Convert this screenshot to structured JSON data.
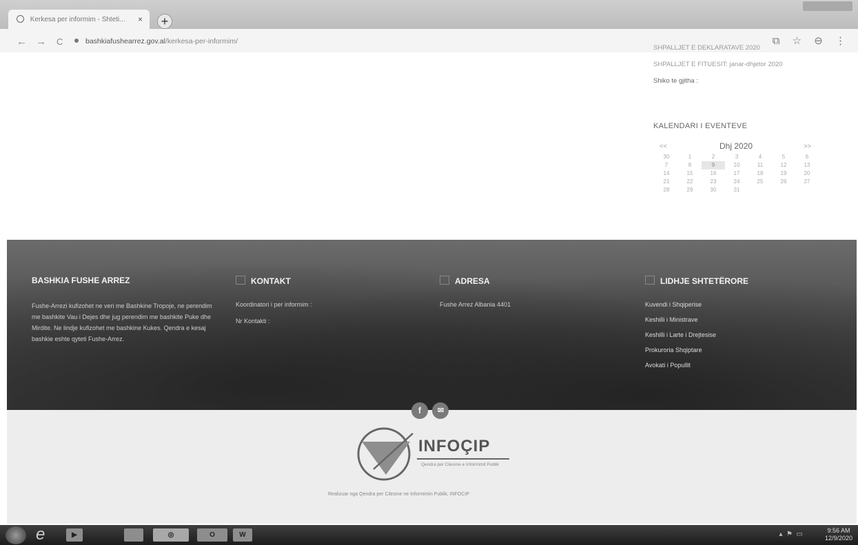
{
  "browser": {
    "tab_title": "Kerkesa per informim - Shteti...",
    "tab_close": "×",
    "new_tab": "+",
    "back": "←",
    "forward": "→",
    "reload": "C",
    "url_host": "bashkiafushearrez.gov.al",
    "url_path": "/kerkesa-per-informim/"
  },
  "sidebar": {
    "line1": "SHPALLJET E DEKLARATAVE 2020",
    "line2": "SHPALLJET E FITUESIT: janar-dhjetor 2020",
    "see_all": "Shiko te gjitha :",
    "calendar_title": "KALENDARI I EVENTEVE",
    "calendar": {
      "prev": "<<",
      "month": "Dhj 2020",
      "next": ">>",
      "rows": [
        [
          "30",
          "1",
          "2",
          "3",
          "4",
          "5",
          "6"
        ],
        [
          "7",
          "8",
          "9",
          "10",
          "11",
          "12",
          "13"
        ],
        [
          "14",
          "15",
          "16",
          "17",
          "18",
          "19",
          "20"
        ],
        [
          "21",
          "22",
          "23",
          "24",
          "25",
          "26",
          "27"
        ],
        [
          "28",
          "29",
          "30",
          "31",
          "",
          "",
          ""
        ]
      ],
      "today": "9"
    }
  },
  "footer": {
    "col1": {
      "title": "BASHKIA FUSHE ARREZ",
      "text": "Fushe-Arrezi kufizohet ne veri me Bashkine Tropoje, ne perendim me bashkite Vau i Dejes dhe jug perendim me bashkite Puke dhe Mirdite. Ne lindje kufizohet me bashkine Kukes. Qendra e kesaj bashkie eshte qyteti Fushe-Arrez."
    },
    "col2": {
      "title": "KONTAKT",
      "line1": "Koordinatori i per informim :",
      "line2": "Nr Kontakti :"
    },
    "col3": {
      "title": "ADRESA",
      "line1": "Fushe Arrez Albania 4401"
    },
    "col4": {
      "title": "LIDHJE SHTETËRORE",
      "links": [
        "Kuvendi i Shqiperise",
        "Keshilli i Ministrave",
        "Keshilli i Larte i Drejtesise",
        "Prokuroria Shqiptare",
        "Avokati i Popullit"
      ]
    },
    "social": {
      "facebook": "f",
      "email": "✉"
    }
  },
  "logo": {
    "brand": "INFOÇIP",
    "tagline": "Qendra per Cilesine e Informimit Publik"
  },
  "credit": "Realizuar nga Qendra per Cilesine ne Informimin Publik, INFOCIP",
  "taskbar": {
    "outlook": "O",
    "word": "W",
    "time": "9:56 AM",
    "date": "12/9/2020"
  }
}
